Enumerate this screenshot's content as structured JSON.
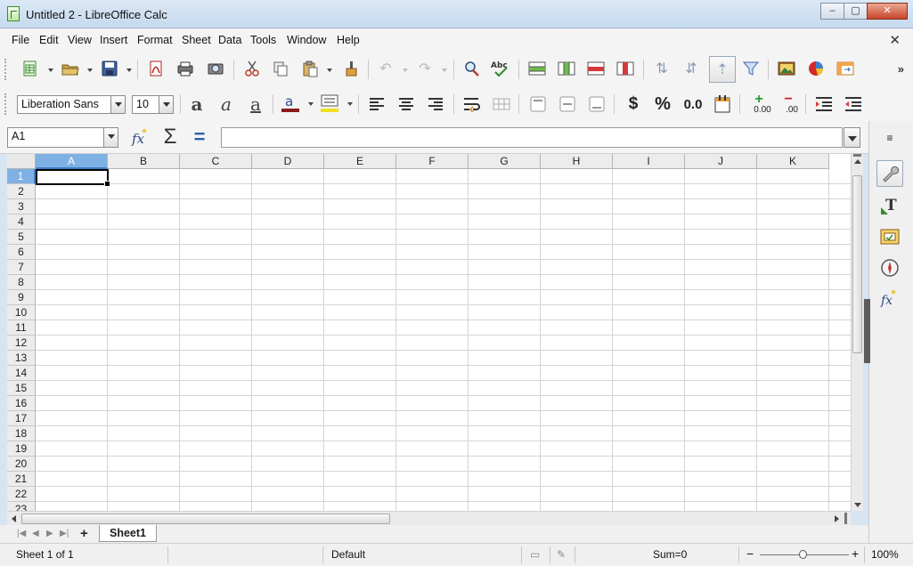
{
  "window": {
    "title": "Untitled 2 - LibreOffice Calc",
    "minimize": "‒",
    "maximize": "▢",
    "close": "✕"
  },
  "menu": {
    "items": [
      "File",
      "Edit",
      "View",
      "Insert",
      "Format",
      "Sheet",
      "Data",
      "Tools",
      "Window",
      "Help"
    ],
    "close_doc": "✕"
  },
  "toolbar2": {
    "font_name": "Liberation Sans",
    "font_size": "10",
    "currency": "$",
    "percent": "%",
    "number_format": "0.0",
    "add_decimal": "0.00",
    "remove_decimal": ".00"
  },
  "formula_bar": {
    "name_box": "A1",
    "formula_value": ""
  },
  "grid": {
    "columns": [
      "A",
      "B",
      "C",
      "D",
      "E",
      "F",
      "G",
      "H",
      "I",
      "J",
      "K"
    ],
    "rows": [
      "1",
      "2",
      "3",
      "4",
      "5",
      "6",
      "7",
      "8",
      "9",
      "10",
      "11",
      "12",
      "13",
      "14",
      "15",
      "16",
      "17",
      "18",
      "19",
      "20",
      "21",
      "22",
      "23"
    ],
    "selected_cell": "A1"
  },
  "tabs": {
    "add": "+",
    "sheets": [
      "Sheet1"
    ]
  },
  "status": {
    "sheet_info": "Sheet 1 of 1",
    "page_style": "Default",
    "sum": "Sum=0",
    "zoom": "100%",
    "zoom_out": "−",
    "zoom_in": "+"
  },
  "colors": {
    "selection_header": "#7fb1e4",
    "chrome": "#f4f4f4",
    "titlebar": "#c5d9ef"
  }
}
